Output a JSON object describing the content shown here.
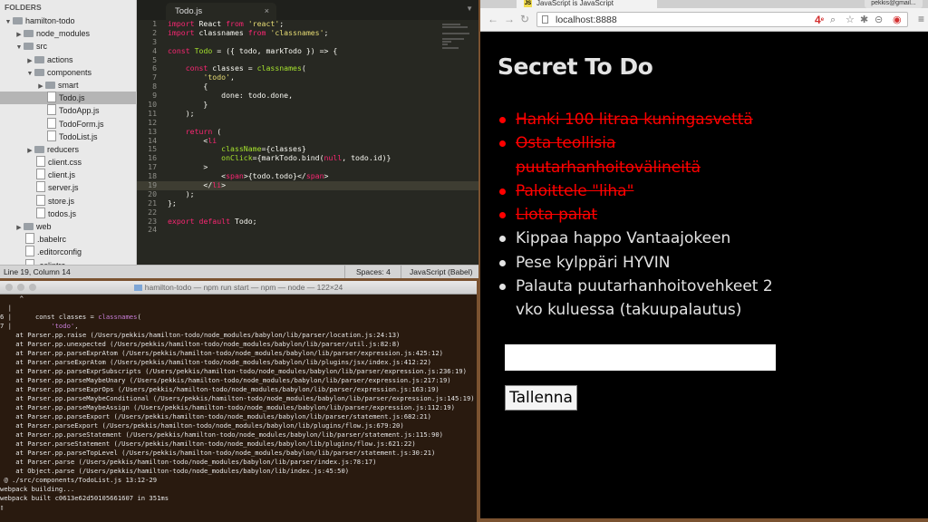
{
  "editor": {
    "folders_heading": "FOLDERS",
    "tree": [
      {
        "label": "hamilton-todo",
        "kind": "folder",
        "depth": 0,
        "open": true
      },
      {
        "label": "node_modules",
        "kind": "folder",
        "depth": 1,
        "open": false
      },
      {
        "label": "src",
        "kind": "folder",
        "depth": 1,
        "open": true
      },
      {
        "label": "actions",
        "kind": "folder",
        "depth": 2,
        "open": false
      },
      {
        "label": "components",
        "kind": "folder",
        "depth": 2,
        "open": true
      },
      {
        "label": "smart",
        "kind": "folder",
        "depth": 3,
        "open": false
      },
      {
        "label": "Todo.js",
        "kind": "file",
        "depth": 3,
        "selected": true
      },
      {
        "label": "TodoApp.js",
        "kind": "file",
        "depth": 3
      },
      {
        "label": "TodoForm.js",
        "kind": "file",
        "depth": 3
      },
      {
        "label": "TodoList.js",
        "kind": "file",
        "depth": 3
      },
      {
        "label": "reducers",
        "kind": "folder",
        "depth": 2,
        "open": false
      },
      {
        "label": "client.css",
        "kind": "file",
        "depth": 2
      },
      {
        "label": "client.js",
        "kind": "file",
        "depth": 2
      },
      {
        "label": "server.js",
        "kind": "file",
        "depth": 2
      },
      {
        "label": "store.js",
        "kind": "file",
        "depth": 2
      },
      {
        "label": "todos.js",
        "kind": "file",
        "depth": 2
      },
      {
        "label": "web",
        "kind": "folder",
        "depth": 1,
        "open": false
      },
      {
        "label": ".babelrc",
        "kind": "file",
        "depth": 1
      },
      {
        "label": ".editorconfig",
        "kind": "file",
        "depth": 1
      },
      {
        "label": ".eslintrc",
        "kind": "file",
        "depth": 1
      }
    ],
    "tab_label": "Todo.js",
    "tab_close": "×",
    "current_line": 19,
    "code_lines": [
      "import React from 'react';",
      "import classnames from 'classnames';",
      "",
      "const Todo = ({ todo, markTodo }) => {",
      "",
      "    const classes = classnames(",
      "        'todo',",
      "        {",
      "            done: todo.done,",
      "        }",
      "    );",
      "",
      "    return (",
      "        <li",
      "            className={classes}",
      "            onClick={markTodo.bind(null, todo.id)}",
      "        >",
      "            <span>{todo.todo}</span>",
      "        </li>",
      "    );",
      "};",
      "",
      "export default Todo;",
      ""
    ],
    "status": {
      "position": "Line 19, Column 14",
      "spaces": "Spaces: 4",
      "syntax": "JavaScript (Babel)"
    }
  },
  "terminal": {
    "title": "hamilton-todo — npm run start — npm — node — 122×24",
    "lines": [
      "     ^",
      "  |",
      "6 |      const classes = classnames(",
      "7 |          'todo',",
      "    at Parser.pp.raise (/Users/pekkis/hamilton-todo/node_modules/babylon/lib/parser/location.js:24:13)",
      "    at Parser.pp.unexpected (/Users/pekkis/hamilton-todo/node_modules/babylon/lib/parser/util.js:82:8)",
      "    at Parser.pp.parseExprAtom (/Users/pekkis/hamilton-todo/node_modules/babylon/lib/parser/expression.js:425:12)",
      "    at Parser.parseExprAtom (/Users/pekkis/hamilton-todo/node_modules/babylon/lib/plugins/jsx/index.js:412:22)",
      "    at Parser.pp.parseExprSubscripts (/Users/pekkis/hamilton-todo/node_modules/babylon/lib/parser/expression.js:236:19)",
      "    at Parser.pp.parseMaybeUnary (/Users/pekkis/hamilton-todo/node_modules/babylon/lib/parser/expression.js:217:19)",
      "    at Parser.pp.parseExprOps (/Users/pekkis/hamilton-todo/node_modules/babylon/lib/parser/expression.js:163:19)",
      "    at Parser.pp.parseMaybeConditional (/Users/pekkis/hamilton-todo/node_modules/babylon/lib/parser/expression.js:145:19)",
      "    at Parser.pp.parseMaybeAssign (/Users/pekkis/hamilton-todo/node_modules/babylon/lib/parser/expression.js:112:19)",
      "    at Parser.pp.parseExport (/Users/pekkis/hamilton-todo/node_modules/babylon/lib/parser/statement.js:682:21)",
      "    at Parser.parseExport (/Users/pekkis/hamilton-todo/node_modules/babylon/lib/plugins/flow.js:679:20)",
      "    at Parser.pp.parseStatement (/Users/pekkis/hamilton-todo/node_modules/babylon/lib/parser/statement.js:115:90)",
      "    at Parser.parseStatement (/Users/pekkis/hamilton-todo/node_modules/babylon/lib/plugins/flow.js:621:22)",
      "    at Parser.pp.parseTopLevel (/Users/pekkis/hamilton-todo/node_modules/babylon/lib/parser/statement.js:30:21)",
      "    at Parser.parse (/Users/pekkis/hamilton-todo/node_modules/babylon/lib/parser/index.js:78:17)",
      "    at Object.parse (/Users/pekkis/hamilton-todo/node_modules/babylon/lib/index.js:45:50)",
      " @ ./src/components/TodoList.js 13:12-29",
      "webpack building...",
      "webpack built c0613e62d50105661607 in 351ms",
      "▯"
    ]
  },
  "browser": {
    "tab_title": "JavaScript is JavaScript",
    "tab_favicon": "JS",
    "user": "pekkis@gmail...",
    "url": "localhost:8888",
    "ext_badge": "4",
    "ext_sup": "e",
    "page": {
      "title": "Secret To Do",
      "todos": [
        {
          "text": "Hanki 100 litraa kuningasvettä",
          "done": true
        },
        {
          "text": "Osta teollisia puutarhanhoitovälineitä",
          "done": true
        },
        {
          "text": "Paloittele \"liha\"",
          "done": true
        },
        {
          "text": "Liota palat",
          "done": true
        },
        {
          "text": "Kippaa happo Vantaajokeen",
          "done": false
        },
        {
          "text": "Pese kylppäri HYVIN",
          "done": false
        },
        {
          "text": "Palauta puutarhanhoitovehkeet 2 vko kuluessa (takuupalautus)",
          "done": false
        }
      ],
      "input_value": "",
      "input_placeholder": "",
      "save_label": "Tallenna"
    }
  },
  "colors": {
    "done": "#ff0000",
    "todo": "#e3e3e3",
    "editor_bg": "#272822"
  }
}
